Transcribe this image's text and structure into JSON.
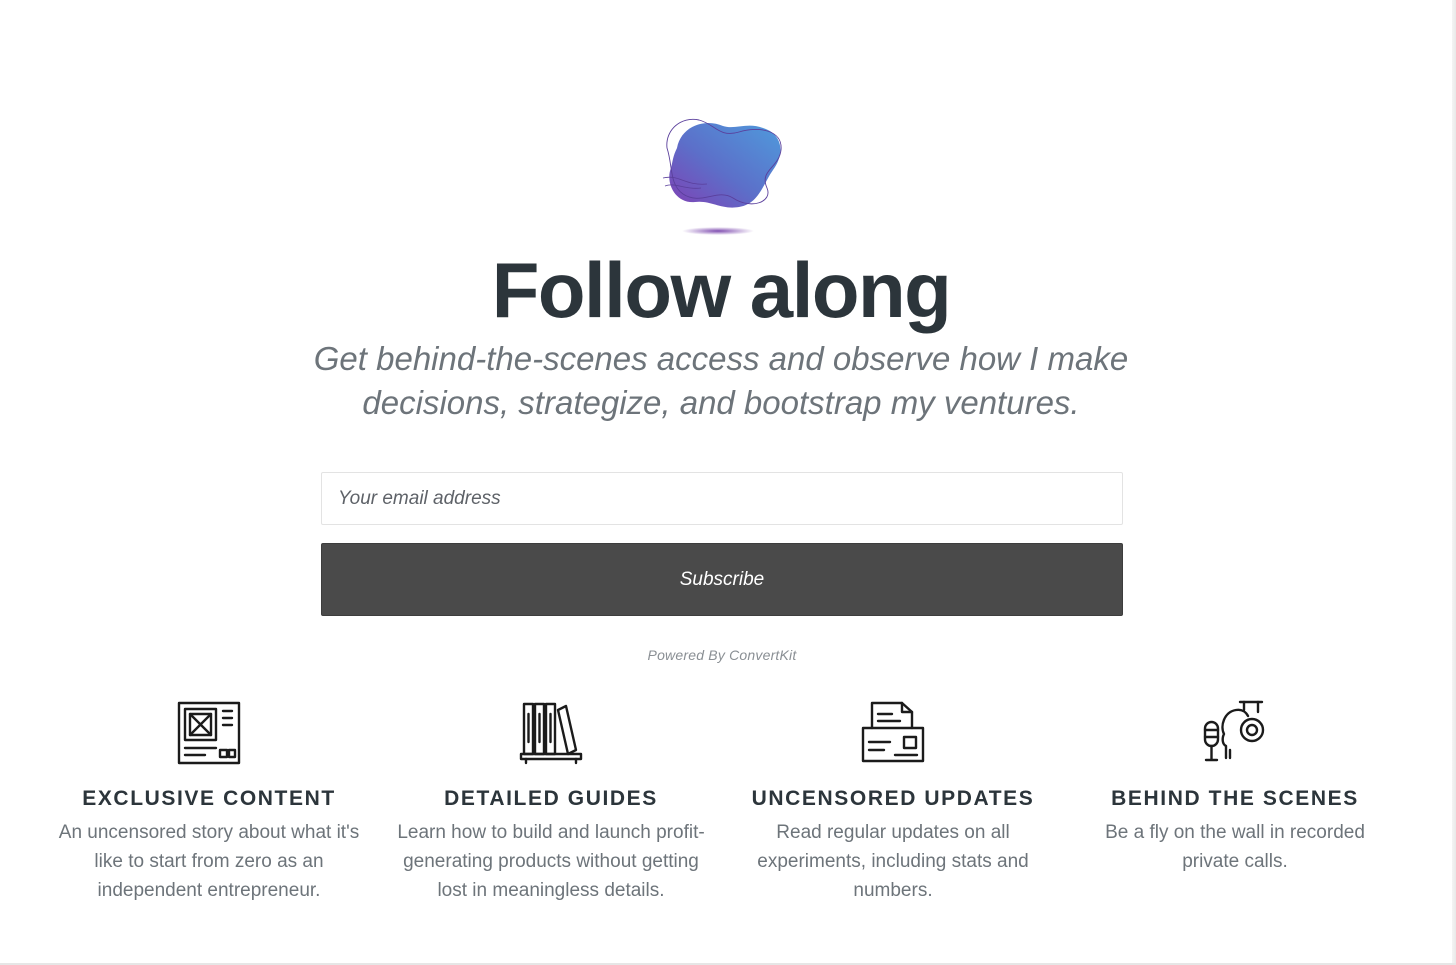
{
  "hero": {
    "title": "Follow along",
    "subtitle": "Get behind-the-scenes access and observe how I make decisions, strategize, and bootstrap my ventures."
  },
  "form": {
    "email_placeholder": "Your email address",
    "subscribe_label": "Subscribe",
    "powered_by": "Powered By ConvertKit"
  },
  "features": [
    {
      "icon": "content-panel-icon",
      "title": "EXCLUSIVE CONTENT",
      "description": "An uncensored story about what it's like to start from zero as an independent entrepreneur."
    },
    {
      "icon": "bookshelf-icon",
      "title": "DETAILED GUIDES",
      "description": "Learn how to build and launch profit-generating products without getting lost in meaningless details."
    },
    {
      "icon": "fax-printer-icon",
      "title": "UNCENSORED UPDATES",
      "description": "Read regular updates on all experiments, including stats and numbers."
    },
    {
      "icon": "podcast-microphone-icon",
      "title": "BEHIND THE SCENES",
      "description": "Be a fly on the wall in recorded private calls."
    }
  ],
  "colors": {
    "heading": "#2c353b",
    "body_text": "#6d747a",
    "button_bg": "#4a4a4a",
    "blob_start": "#4a8fd6",
    "blob_end": "#7b3fb0"
  }
}
